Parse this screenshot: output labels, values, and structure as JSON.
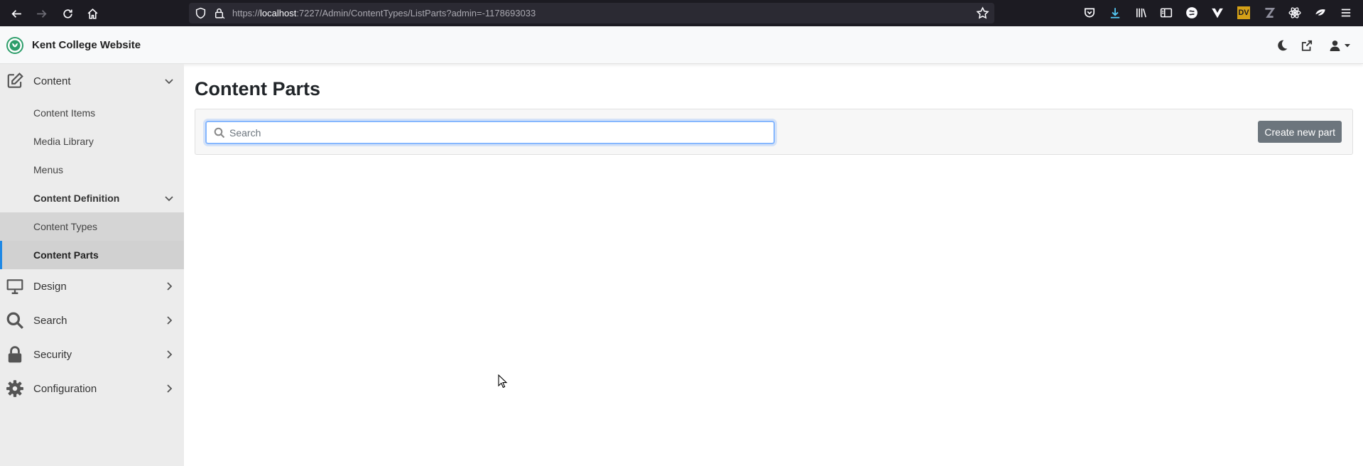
{
  "browser": {
    "url_prefix": "https://",
    "url_host": "localhost",
    "url_rest": ":7227/Admin/ContentTypes/ListParts?admin=-1178693033",
    "toolbar_badge": "DV"
  },
  "header": {
    "brand": "Kent College Website",
    "brand_color": "#2e9e6b"
  },
  "sidebar": {
    "items": [
      {
        "label": "Content",
        "icon": "pencil-square-icon"
      },
      {
        "label": "Content Items"
      },
      {
        "label": "Media Library"
      },
      {
        "label": "Menus"
      },
      {
        "label": "Content Definition"
      },
      {
        "label": "Content Types"
      },
      {
        "label": "Content Parts"
      },
      {
        "label": "Design",
        "icon": "monitor-icon"
      },
      {
        "label": "Search",
        "icon": "search-icon"
      },
      {
        "label": "Security",
        "icon": "lock-icon"
      },
      {
        "label": "Configuration",
        "icon": "gear-icon"
      }
    ],
    "active_accent": "#1e88e5"
  },
  "main": {
    "title": "Content Parts",
    "search_placeholder": "Search",
    "search_value": "",
    "create_button": "Create new part"
  }
}
